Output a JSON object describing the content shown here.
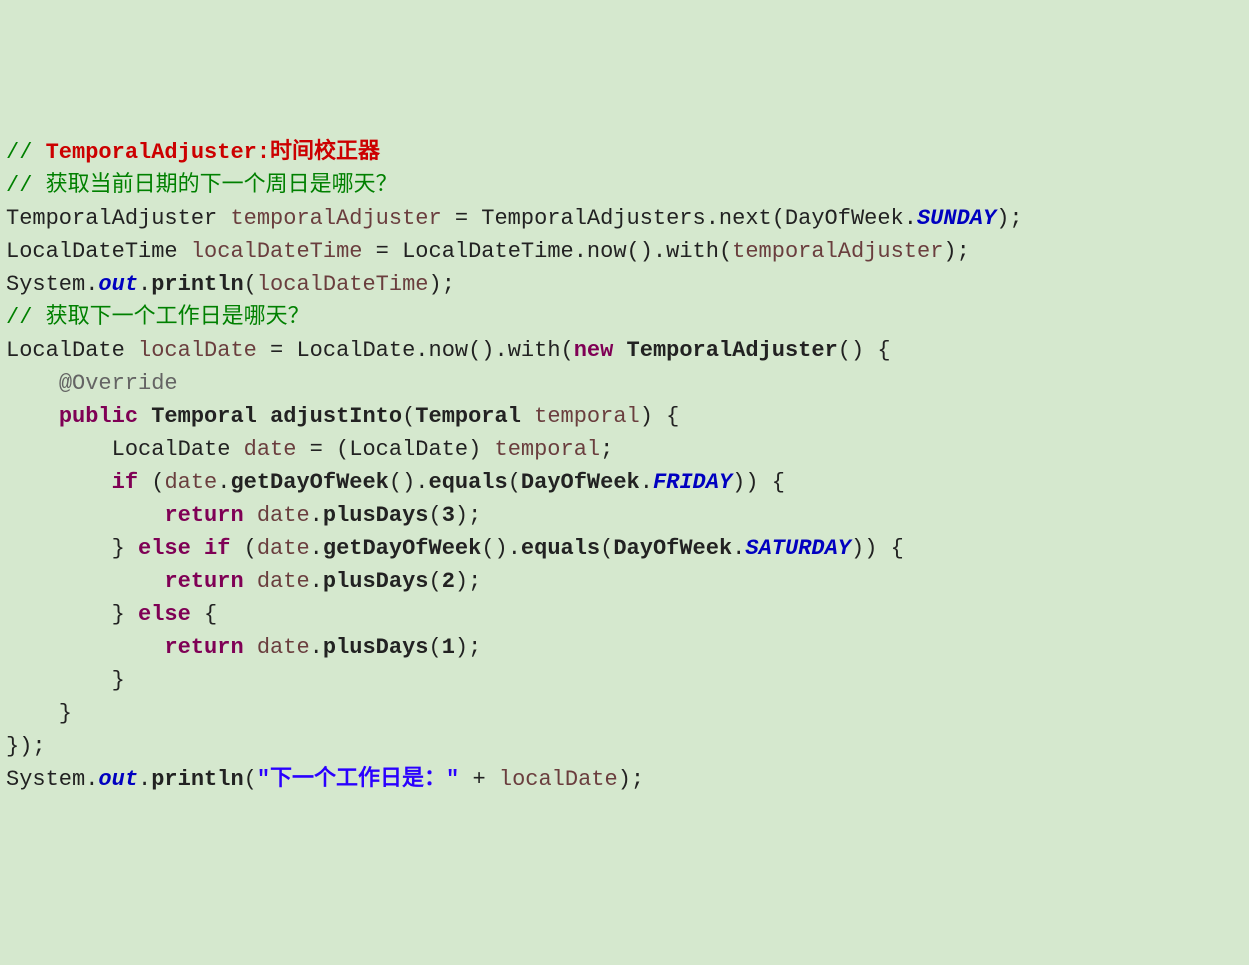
{
  "lines": [
    [
      {
        "cls": "c-comment",
        "t": "// "
      },
      {
        "cls": "c-red",
        "t": "TemporalAdjuster:时间校正器"
      }
    ],
    [
      {
        "cls": "c-comment",
        "t": "// 获取当前日期的下一个周日是哪天？"
      }
    ],
    [
      {
        "cls": "c-plain",
        "t": "TemporalAdjuster "
      },
      {
        "cls": "c-var",
        "t": "temporalAdjuster"
      },
      {
        "cls": "c-plain",
        "t": " = TemporalAdjusters."
      },
      {
        "cls": "c-plain",
        "t": "next"
      },
      {
        "cls": "c-plain",
        "t": "(DayOfWeek."
      },
      {
        "cls": "c-const",
        "t": "SUNDAY"
      },
      {
        "cls": "c-plain",
        "t": ");"
      }
    ],
    [
      {
        "cls": "c-plain",
        "t": "LocalDateTime "
      },
      {
        "cls": "c-var",
        "t": "localDateTime"
      },
      {
        "cls": "c-plain",
        "t": " = LocalDateTime."
      },
      {
        "cls": "c-plain",
        "t": "now"
      },
      {
        "cls": "c-plain",
        "t": "().with("
      },
      {
        "cls": "c-var",
        "t": "temporalAdjuster"
      },
      {
        "cls": "c-plain",
        "t": ");"
      }
    ],
    [
      {
        "cls": "c-plain",
        "t": "System."
      },
      {
        "cls": "c-const",
        "t": "out"
      },
      {
        "cls": "c-plain",
        "t": "."
      },
      {
        "cls": "c-method",
        "t": "println"
      },
      {
        "cls": "c-plain",
        "t": "("
      },
      {
        "cls": "c-var",
        "t": "localDateTime"
      },
      {
        "cls": "c-plain",
        "t": ");"
      }
    ],
    [
      {
        "cls": "c-comment",
        "t": "// 获取下一个工作日是哪天？"
      }
    ],
    [
      {
        "cls": "c-plain",
        "t": "LocalDate "
      },
      {
        "cls": "c-var",
        "t": "localDate"
      },
      {
        "cls": "c-plain",
        "t": " = LocalDate."
      },
      {
        "cls": "c-plain",
        "t": "now"
      },
      {
        "cls": "c-plain",
        "t": "().with("
      },
      {
        "cls": "c-kw",
        "t": "new"
      },
      {
        "cls": "c-plain",
        "t": " "
      },
      {
        "cls": "c-method",
        "t": "TemporalAdjuster"
      },
      {
        "cls": "c-plain",
        "t": "() {"
      }
    ],
    [
      {
        "cls": "c-plain",
        "t": "    "
      },
      {
        "cls": "c-ann",
        "t": "@Override"
      }
    ],
    [
      {
        "cls": "c-plain",
        "t": "    "
      },
      {
        "cls": "c-kw",
        "t": "public"
      },
      {
        "cls": "c-plain",
        "t": " "
      },
      {
        "cls": "c-method",
        "t": "Temporal"
      },
      {
        "cls": "c-plain",
        "t": " "
      },
      {
        "cls": "c-method",
        "t": "adjustInto"
      },
      {
        "cls": "c-plain",
        "t": "("
      },
      {
        "cls": "c-method",
        "t": "Temporal"
      },
      {
        "cls": "c-plain",
        "t": " "
      },
      {
        "cls": "c-var",
        "t": "temporal"
      },
      {
        "cls": "c-plain",
        "t": ") {"
      }
    ],
    [
      {
        "cls": "c-plain",
        "t": "        LocalDate "
      },
      {
        "cls": "c-var",
        "t": "date"
      },
      {
        "cls": "c-plain",
        "t": " = (LocalDate) "
      },
      {
        "cls": "c-var",
        "t": "temporal"
      },
      {
        "cls": "c-plain",
        "t": ";"
      }
    ],
    [
      {
        "cls": "c-plain",
        "t": "        "
      },
      {
        "cls": "c-kw",
        "t": "if"
      },
      {
        "cls": "c-plain",
        "t": " ("
      },
      {
        "cls": "c-var",
        "t": "date"
      },
      {
        "cls": "c-plain",
        "t": "."
      },
      {
        "cls": "c-method",
        "t": "getDayOfWeek"
      },
      {
        "cls": "c-plain",
        "t": "()."
      },
      {
        "cls": "c-method",
        "t": "equals"
      },
      {
        "cls": "c-plain",
        "t": "("
      },
      {
        "cls": "c-method",
        "t": "DayOfWeek"
      },
      {
        "cls": "c-plain",
        "t": "."
      },
      {
        "cls": "c-const",
        "t": "FRIDAY"
      },
      {
        "cls": "c-plain",
        "t": ")) {"
      }
    ],
    [
      {
        "cls": "c-plain",
        "t": "            "
      },
      {
        "cls": "c-kw",
        "t": "return"
      },
      {
        "cls": "c-plain",
        "t": " "
      },
      {
        "cls": "c-var",
        "t": "date"
      },
      {
        "cls": "c-plain",
        "t": "."
      },
      {
        "cls": "c-method",
        "t": "plusDays"
      },
      {
        "cls": "c-plain",
        "t": "("
      },
      {
        "cls": "c-method",
        "t": "3"
      },
      {
        "cls": "c-plain",
        "t": ");"
      }
    ],
    [
      {
        "cls": "c-plain",
        "t": "        } "
      },
      {
        "cls": "c-kw",
        "t": "else if"
      },
      {
        "cls": "c-plain",
        "t": " ("
      },
      {
        "cls": "c-var",
        "t": "date"
      },
      {
        "cls": "c-plain",
        "t": "."
      },
      {
        "cls": "c-method",
        "t": "getDayOfWeek"
      },
      {
        "cls": "c-plain",
        "t": "()."
      },
      {
        "cls": "c-method",
        "t": "equals"
      },
      {
        "cls": "c-plain",
        "t": "("
      },
      {
        "cls": "c-method",
        "t": "DayOfWeek"
      },
      {
        "cls": "c-plain",
        "t": "."
      },
      {
        "cls": "c-const",
        "t": "SATURDAY"
      },
      {
        "cls": "c-plain",
        "t": ")) {"
      }
    ],
    [
      {
        "cls": "c-plain",
        "t": "            "
      },
      {
        "cls": "c-kw",
        "t": "return"
      },
      {
        "cls": "c-plain",
        "t": " "
      },
      {
        "cls": "c-var",
        "t": "date"
      },
      {
        "cls": "c-plain",
        "t": "."
      },
      {
        "cls": "c-method",
        "t": "plusDays"
      },
      {
        "cls": "c-plain",
        "t": "("
      },
      {
        "cls": "c-method",
        "t": "2"
      },
      {
        "cls": "c-plain",
        "t": ");"
      }
    ],
    [
      {
        "cls": "c-plain",
        "t": "        } "
      },
      {
        "cls": "c-kw",
        "t": "else"
      },
      {
        "cls": "c-plain",
        "t": " {"
      }
    ],
    [
      {
        "cls": "c-plain",
        "t": "            "
      },
      {
        "cls": "c-kw",
        "t": "return"
      },
      {
        "cls": "c-plain",
        "t": " "
      },
      {
        "cls": "c-var",
        "t": "date"
      },
      {
        "cls": "c-plain",
        "t": "."
      },
      {
        "cls": "c-method",
        "t": "plusDays"
      },
      {
        "cls": "c-plain",
        "t": "("
      },
      {
        "cls": "c-method",
        "t": "1"
      },
      {
        "cls": "c-plain",
        "t": ");"
      }
    ],
    [
      {
        "cls": "c-plain",
        "t": "        }"
      }
    ],
    [
      {
        "cls": "c-plain",
        "t": "    }"
      }
    ],
    [
      {
        "cls": "c-plain",
        "t": "});"
      }
    ],
    [
      {
        "cls": "c-plain",
        "t": "System."
      },
      {
        "cls": "c-const",
        "t": "out"
      },
      {
        "cls": "c-plain",
        "t": "."
      },
      {
        "cls": "c-method",
        "t": "println"
      },
      {
        "cls": "c-plain",
        "t": "("
      },
      {
        "cls": "c-str",
        "t": "\"下一个工作日是：\""
      },
      {
        "cls": "c-plain",
        "t": " + "
      },
      {
        "cls": "c-var",
        "t": "localDate"
      },
      {
        "cls": "c-plain",
        "t": ");"
      }
    ]
  ]
}
